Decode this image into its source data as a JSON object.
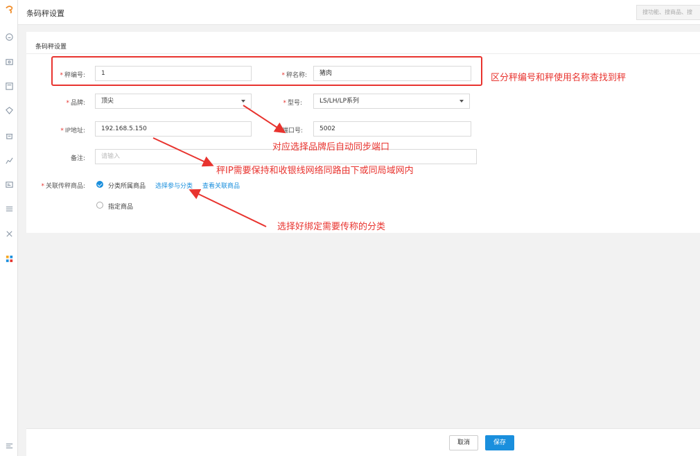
{
  "app": {
    "page_title": "条码秤设置",
    "search_placeholder": "搜功能、搜商品、搜"
  },
  "sidebar_icons": [
    "home-icon",
    "cashier-icon",
    "goods-icon",
    "member-icon",
    "shop-icon",
    "report-icon",
    "card-icon",
    "settings-icon",
    "tools-icon",
    "apps-icon",
    "collapse-icon"
  ],
  "form": {
    "section_title": "条码秤设置",
    "scale_no": {
      "label": "秤编号:",
      "value": "1"
    },
    "scale_name": {
      "label": "秤名称:",
      "value": "猪肉"
    },
    "brand": {
      "label": "品牌:",
      "value": "顶尖"
    },
    "model": {
      "label": "型号:",
      "value": "LS/LH/LP系列"
    },
    "ip": {
      "label": "IP地址:",
      "value": "192.168.5.150"
    },
    "port": {
      "label": "端口号:",
      "value": "5002"
    },
    "remark": {
      "label": "备注:",
      "placeholder": "请输入"
    },
    "related_goods": {
      "label": "关联传秤商品:",
      "option_category": "分类所属商品",
      "option_category_selected": true,
      "select_category_link": "选择参与分类",
      "view_goods_link": "查看关联商品",
      "option_specific": "指定商品",
      "option_specific_selected": false
    }
  },
  "footer": {
    "cancel": "取消",
    "save": "保存"
  },
  "annotations": {
    "name_note": "区分秤编号和秤使用名称查找到秤",
    "port_note": "对应选择品牌后自动同步端口",
    "ip_note": "秤IP需要保持和收银线网络同路由下或同局域网内",
    "category_note": "选择好绑定需要传称的分类",
    "color": "#e8332e"
  },
  "colors": {
    "accent": "#1a8fdd",
    "required": "#e5322d"
  }
}
